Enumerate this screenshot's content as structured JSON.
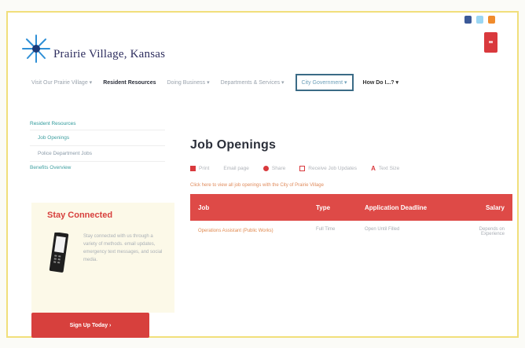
{
  "site": {
    "title": "Prairie Village, Kansas",
    "social": [
      "facebook-icon",
      "twitter-icon",
      "rss-icon"
    ]
  },
  "nav": {
    "items": [
      {
        "label": "Visit Our Prairie Village ▾",
        "bold": false,
        "boxed": false
      },
      {
        "label": "Resident Resources",
        "bold": true,
        "boxed": false
      },
      {
        "label": "Doing Business ▾",
        "bold": false,
        "boxed": false
      },
      {
        "label": "Departments & Services ▾",
        "bold": false,
        "boxed": false
      },
      {
        "label": "City Government ▾",
        "bold": false,
        "boxed": true
      },
      {
        "label": "How Do I...? ▾",
        "bold": false,
        "boxed": false,
        "dark": true
      }
    ]
  },
  "sidebar": {
    "heading": "Resident Resources",
    "items": [
      {
        "label": "Job Openings",
        "alt": false
      },
      {
        "label": "Police Department Jobs",
        "alt": true
      }
    ],
    "last": "Benefits Overview"
  },
  "stay_connected": {
    "title": "Stay Connected",
    "text": "Stay connected with us through a variety of methods. email updates, emergency text messages, and social media.",
    "button": "Sign Up Today ›"
  },
  "main": {
    "title": "Job Openings",
    "tools": [
      {
        "label": "Print",
        "icon": "square"
      },
      {
        "label": "Email page",
        "icon": "none"
      },
      {
        "label": "Share",
        "icon": "circle"
      },
      {
        "label": "Receive Job Updates",
        "icon": "box"
      },
      {
        "label": "Text Size",
        "icon": "A"
      }
    ],
    "click_here": "Click here to view all job openings with the City of Prairie Village",
    "table": {
      "headers": [
        "Job",
        "Type",
        "Application Deadline",
        "Salary"
      ],
      "rows": [
        {
          "job": "Operations Assistant (Public Works)",
          "type": "Full Time",
          "deadline": "Open Until Filled",
          "salary": "Depends on Experience"
        }
      ]
    }
  },
  "colors": {
    "accent_red": "#d7403d",
    "teal": "#3f9fa0",
    "navy": "#2d2d5e",
    "frame_yellow": "#f1df7b"
  }
}
